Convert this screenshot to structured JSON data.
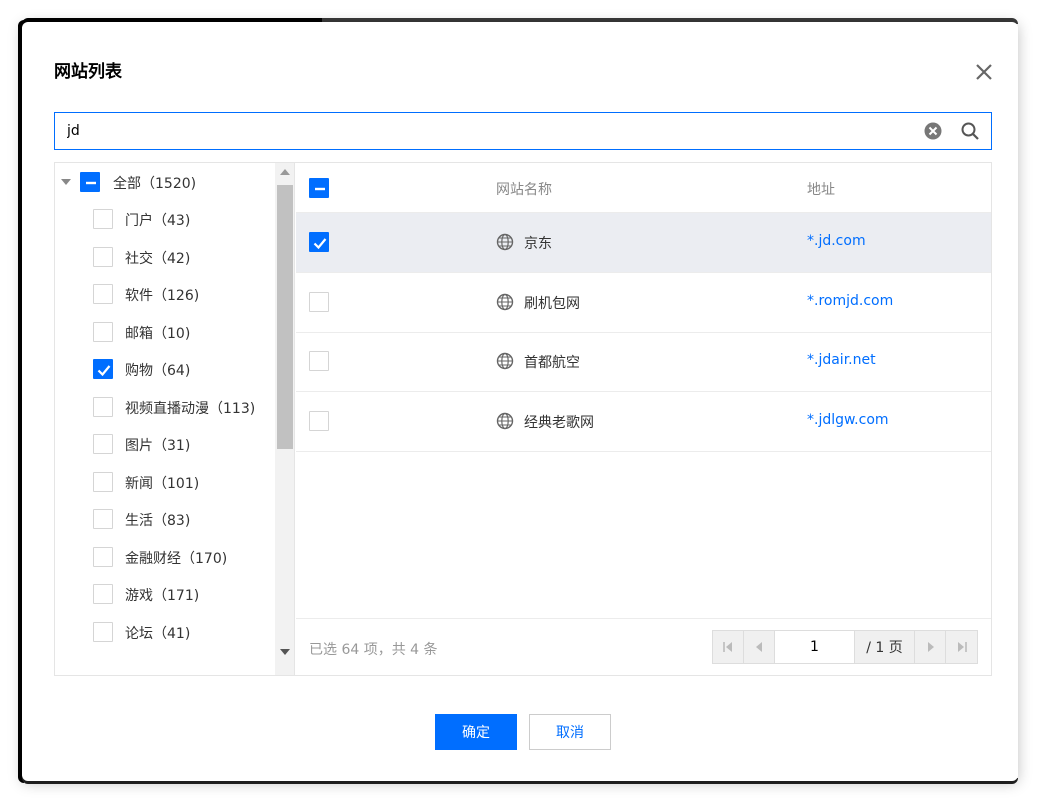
{
  "dialog": {
    "title": "网站列表"
  },
  "search": {
    "value": "jd"
  },
  "tree": {
    "root": {
      "label": "全部（1520)",
      "state": "partial"
    },
    "items": [
      {
        "label": "门户（43)",
        "checked": false
      },
      {
        "label": "社交（42)",
        "checked": false
      },
      {
        "label": "软件（126)",
        "checked": false
      },
      {
        "label": "邮箱（10)",
        "checked": false
      },
      {
        "label": "购物（64)",
        "checked": true
      },
      {
        "label": "视频直播动漫（113)",
        "checked": false
      },
      {
        "label": "图片（31)",
        "checked": false
      },
      {
        "label": "新闻（101)",
        "checked": false
      },
      {
        "label": "生活（83)",
        "checked": false
      },
      {
        "label": "金融财经（170)",
        "checked": false
      },
      {
        "label": "游戏（171)",
        "checked": false
      },
      {
        "label": "论坛（41)",
        "checked": false
      }
    ]
  },
  "table": {
    "columns": [
      "网站名称",
      "地址"
    ],
    "rows": [
      {
        "name": "京东",
        "address": "*.jd.com",
        "checked": true
      },
      {
        "name": "刷机包网",
        "address": "*.romjd.com",
        "checked": false
      },
      {
        "name": "首都航空",
        "address": "*.jdair.net",
        "checked": false
      },
      {
        "name": "经典老歌网",
        "address": "*.jdlgw.com",
        "checked": false
      }
    ]
  },
  "footer": {
    "summary": "已选 64 项，共 4 条",
    "page_current": "1",
    "page_total": "/ 1 页"
  },
  "buttons": {
    "ok": "确定",
    "cancel": "取消"
  },
  "colors": {
    "accent": "#006eff",
    "selected_row": "#ebedf2"
  }
}
